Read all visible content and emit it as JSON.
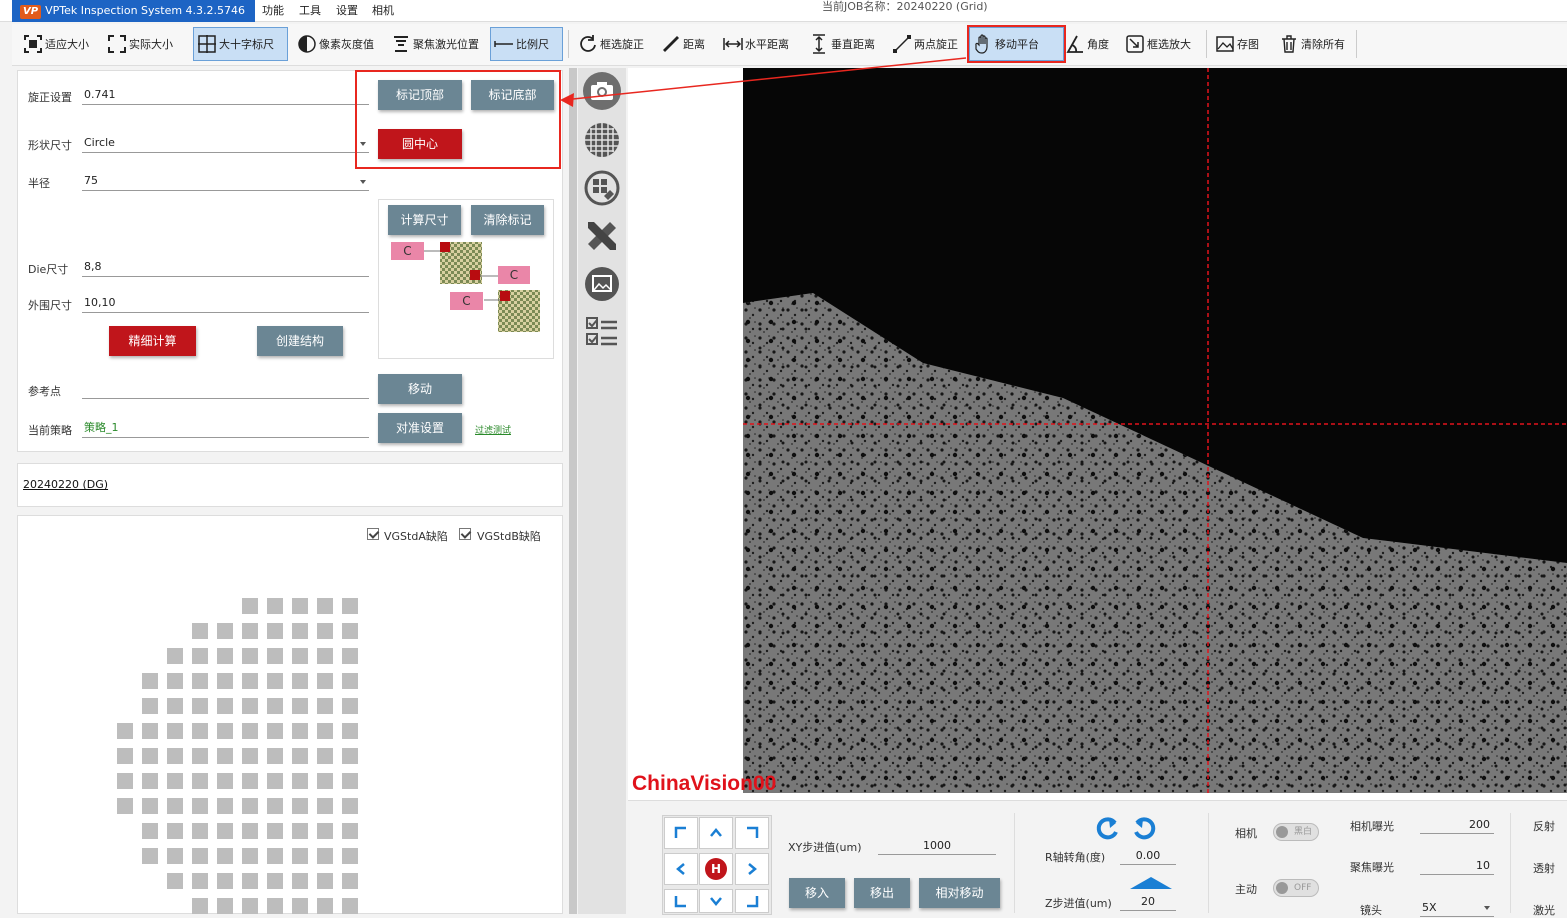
{
  "app": {
    "logo": "VP",
    "title": "VPTek Inspection System 4.3.2.5746",
    "job": "当前JOB名称：20240220 (Grid)"
  },
  "menu": [
    "功能",
    "工具",
    "设置",
    "相机"
  ],
  "toolbar": {
    "fit": "适应大小",
    "actual": "实际大小",
    "crosshair": "大十字标尺",
    "gray": "像素灰度值",
    "laser": "聚焦激光位置",
    "scale": "比例尺",
    "rotate_sel": "框选旋正",
    "distance": "距离",
    "hdist": "水平距离",
    "vdist": "垂直距离",
    "two_point": "两点旋正",
    "move_stage": "移动平台",
    "angle": "角度",
    "zoom_sel": "框选放大",
    "save": "存图",
    "clear": "清除所有"
  },
  "form": {
    "rotate_label": "旋正设置",
    "rotate_value": "0.741",
    "shape_label": "形状尺寸",
    "shape_value": "Circle",
    "radius_label": "半径",
    "radius_value": "75",
    "die_label": "Die尺寸",
    "die_value": "8,8",
    "outer_label": "外围尺寸",
    "outer_value": "10,10",
    "ref_label": "参考点",
    "ref_value": "",
    "strategy_label": "当前策略",
    "strategy_value": "策略_1",
    "strategy_link": "过滤测试"
  },
  "buttons": {
    "mark_top": "标记顶部",
    "mark_bottom": "标记底部",
    "circle_center": "圆中心",
    "calc_size": "计算尺寸",
    "clear_mark": "清除标记",
    "fine_calc": "精细计算",
    "create_struct": "创建结构",
    "move": "移动",
    "align_settings": "对准设置"
  },
  "diagram": {
    "c1": "C",
    "c2": "C",
    "c3": "C"
  },
  "job_link": "20240220 (DG)",
  "defects": {
    "a": "VGStdA缺陷",
    "b": "VGStdB缺陷"
  },
  "watermark": "ChinaVision00",
  "stage": {
    "xy_label": "XY步进值(um)",
    "xy_value": "1000",
    "move_in": "移入",
    "move_out": "移出",
    "relative_move": "相对移动",
    "home": "H",
    "r_label": "R轴转角(度)",
    "r_value": "0.00",
    "z_label": "Z步进值(um)",
    "z_value": "20"
  },
  "camera": {
    "camera_label": "相机",
    "camera_toggle": "黑白",
    "active_label": "主动",
    "active_toggle": "OFF",
    "exposure_label": "相机曝光",
    "exposure_value": "200",
    "focus_label": "聚焦曝光",
    "focus_value": "10",
    "lens_label": "镜头",
    "lens_value": "5X",
    "reflect_label": "反射",
    "transmit_label": "透射",
    "laser_label": "激光"
  },
  "colors": {
    "accent": "#1d64c4",
    "red": "#c0151b",
    "highlight": "#e8271f",
    "button": "#6b8694"
  }
}
